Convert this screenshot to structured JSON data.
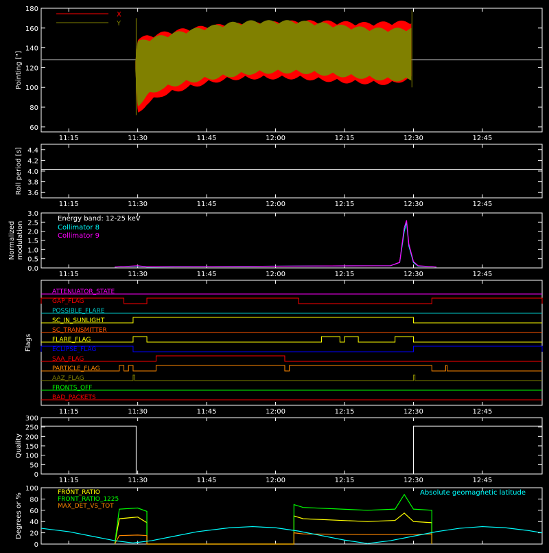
{
  "x_axis": {
    "range": [
      "11:09",
      "12:58"
    ],
    "ticks": [
      "11:15",
      "11:30",
      "11:45",
      "12:00",
      "12:15",
      "12:30",
      "12:45"
    ]
  },
  "chart_data": [
    {
      "id": "pointing",
      "type": "area",
      "ylabel": "Pointing [\"]",
      "ylim": [
        55,
        180
      ],
      "yticks": [
        60,
        80,
        100,
        120,
        140,
        160,
        180
      ],
      "reference_line": 128,
      "legend": [
        {
          "name": "X",
          "color": "#ff0000"
        },
        {
          "name": "Y",
          "color": "#808000"
        }
      ],
      "series": [
        {
          "name": "X",
          "color": "#ff0000",
          "x": [
            "11:29:30",
            "11:30",
            "11:32",
            "11:35",
            "11:40",
            "11:45",
            "11:50",
            "11:55",
            "12:00",
            "12:05",
            "12:10",
            "12:15",
            "12:20",
            "12:25",
            "12:29:40"
          ],
          "upper": [
            130,
            150,
            153,
            156,
            160,
            163,
            165,
            166,
            167,
            168,
            168,
            167,
            166,
            167,
            168
          ],
          "lower": [
            115,
            72,
            82,
            90,
            97,
            103,
            107,
            108,
            108,
            108,
            106,
            104,
            103,
            102,
            108
          ]
        },
        {
          "name": "Y",
          "color": "#808000",
          "x": [
            "11:29:30",
            "11:30",
            "11:32",
            "11:35",
            "11:40",
            "11:45",
            "11:50",
            "11:55",
            "12:00",
            "12:05",
            "12:10",
            "12:15",
            "12:20",
            "12:25",
            "12:29:40"
          ],
          "upper": [
            128,
            147,
            150,
            153,
            158,
            162,
            166,
            168,
            168,
            168,
            166,
            163,
            161,
            160,
            161
          ],
          "lower": [
            115,
            80,
            90,
            97,
            103,
            107,
            110,
            113,
            114,
            114,
            112,
            110,
            108,
            106,
            106
          ]
        }
      ]
    },
    {
      "id": "roll",
      "type": "line",
      "ylabel": "Roll period [s]",
      "ylim": [
        3.5,
        4.5
      ],
      "yticks": [
        3.6,
        3.8,
        4.0,
        4.2,
        4.4
      ],
      "series": [
        {
          "name": "roll",
          "color": "#ffffff",
          "x": [
            "11:09",
            "12:58"
          ],
          "y": [
            4.03,
            4.03
          ]
        }
      ]
    },
    {
      "id": "modulation",
      "type": "line",
      "ylabel": [
        "Normalized",
        "modulation"
      ],
      "ylim": [
        0,
        3.0
      ],
      "yticks": [
        0.0,
        0.5,
        1.0,
        1.5,
        2.0,
        2.5,
        3.0
      ],
      "legend_title": "Energy band: 12-25 keV",
      "legend": [
        {
          "name": "Collimator 8",
          "color": "#00ffff"
        },
        {
          "name": "Collimator 9",
          "color": "#ff00ff"
        }
      ],
      "series": [
        {
          "name": "Collimator 8",
          "color": "#00ffff",
          "x": [
            "11:25",
            "11:30",
            "11:32",
            "12:04",
            "12:25",
            "12:27",
            "12:28",
            "12:28:30",
            "12:29",
            "12:30",
            "12:31",
            "12:35"
          ],
          "y": [
            0.05,
            0.1,
            0.05,
            0.1,
            0.12,
            0.3,
            2.0,
            2.5,
            1.2,
            0.3,
            0.1,
            0.05
          ]
        },
        {
          "name": "Collimator 9",
          "color": "#ff00ff",
          "x": [
            "11:25",
            "11:30",
            "11:32",
            "12:04",
            "12:25",
            "12:27",
            "12:28",
            "12:28:30",
            "12:29",
            "12:30",
            "12:31",
            "12:35"
          ],
          "y": [
            0.05,
            0.12,
            0.06,
            0.1,
            0.12,
            0.3,
            2.2,
            2.6,
            1.3,
            0.35,
            0.12,
            0.05
          ]
        }
      ]
    },
    {
      "id": "flags",
      "type": "line",
      "ylabel": "Flags",
      "flags": [
        {
          "name": "ATTENUATOR_STATE",
          "color": "#ff00ff",
          "high": []
        },
        {
          "name": "GAP_FLAG",
          "color": "#ff0000",
          "high": [
            [
              "11:09",
              "11:27"
            ],
            [
              "11:32",
              "12:05"
            ],
            [
              "12:34",
              "12:58"
            ]
          ]
        },
        {
          "name": "POSSIBLE_FLARE",
          "color": "#00cccc",
          "high": []
        },
        {
          "name": "SC_IN_SUNLIGHT",
          "color": "#ffff00",
          "high": [
            [
              "11:29",
              "12:30"
            ]
          ]
        },
        {
          "name": "SC_TRANSMITTER",
          "color": "#ff5500",
          "high": []
        },
        {
          "name": "FLARE_FLAG",
          "color": "#ffff00",
          "high": [
            [
              "11:29",
              "11:32"
            ],
            [
              "12:10",
              "12:14"
            ],
            [
              "12:15",
              "12:18"
            ],
            [
              "12:26",
              "12:30"
            ]
          ]
        },
        {
          "name": "ECLIPSE_FLAG",
          "color": "#0000ff",
          "high": [
            [
              "11:09",
              "11:29"
            ],
            [
              "12:30",
              "12:58"
            ]
          ]
        },
        {
          "name": "SAA_FLAG",
          "color": "#ff0000",
          "high": [
            [
              "11:34",
              "12:02"
            ]
          ]
        },
        {
          "name": "PARTICLE_FLAG",
          "color": "#ff8800",
          "high": [
            [
              "11:26",
              "11:27"
            ],
            [
              "11:28",
              "11:29"
            ],
            [
              "11:34",
              "12:02"
            ],
            [
              "12:03",
              "12:34"
            ],
            [
              "12:37",
              "12:37:20"
            ]
          ]
        },
        {
          "name": "AAZ_FLAG",
          "color": "#808000",
          "high": [
            [
              "11:29",
              "11:29:20"
            ],
            [
              "12:30",
              "12:30:20"
            ]
          ]
        },
        {
          "name": "FRONTS_OFF",
          "color": "#00ff00",
          "high": []
        },
        {
          "name": "BAD_PACKETS",
          "color": "#ff0000",
          "high": []
        }
      ]
    },
    {
      "id": "quality",
      "type": "line",
      "ylabel": "Quality",
      "ylim": [
        0,
        300
      ],
      "yticks": [
        0,
        50,
        100,
        150,
        200,
        250,
        300
      ],
      "series": [
        {
          "name": "quality",
          "color": "#ffffff",
          "x": [
            "11:09",
            "11:29:40",
            "11:29:40",
            "12:30",
            "12:30",
            "12:58"
          ],
          "y": [
            255,
            255,
            0,
            0,
            255,
            255
          ]
        }
      ]
    },
    {
      "id": "ratios",
      "type": "line",
      "ylabel": "Degrees or %",
      "ylim": [
        0,
        100
      ],
      "yticks": [
        0,
        20,
        40,
        60,
        80,
        100
      ],
      "legend": [
        {
          "name": "FRONT_RATIO",
          "color": "#ffff00"
        },
        {
          "name": "FRONT_RATIO_1225",
          "color": "#00ff00"
        },
        {
          "name": "MAX_DET_VS_TOT",
          "color": "#ff8800"
        }
      ],
      "annotation": {
        "text": "Absolute geomagnetic latitude",
        "color": "#00ffff"
      },
      "series": [
        {
          "name": "FRONT_RATIO",
          "color": "#ffff00",
          "x": [
            "11:25",
            "11:26",
            "11:30",
            "11:32",
            "11:32",
            "12:04",
            "12:04",
            "12:06",
            "12:20",
            "12:26",
            "12:28",
            "12:30",
            "12:34",
            "12:34"
          ],
          "y": [
            0,
            45,
            48,
            38,
            0,
            0,
            50,
            45,
            40,
            42,
            55,
            40,
            38,
            0
          ]
        },
        {
          "name": "FRONT_RATIO_1225",
          "color": "#00ff00",
          "x": [
            "11:25",
            "11:26",
            "11:30",
            "11:32",
            "11:32",
            "12:04",
            "12:04",
            "12:06",
            "12:20",
            "12:26",
            "12:28",
            "12:30",
            "12:34",
            "12:34"
          ],
          "y": [
            0,
            62,
            64,
            58,
            0,
            0,
            70,
            65,
            60,
            62,
            88,
            62,
            60,
            0
          ]
        },
        {
          "name": "MAX_DET_VS_TOT",
          "color": "#ff8800",
          "x": [
            "11:25",
            "11:26",
            "11:30",
            "11:32",
            "11:32",
            "12:04",
            "12:04",
            "12:06",
            "12:20",
            "12:30",
            "12:34",
            "12:34"
          ],
          "y": [
            0,
            15,
            16,
            15,
            0,
            0,
            20,
            18,
            17,
            17,
            18,
            0
          ]
        },
        {
          "name": "Absolute geomagnetic latitude",
          "color": "#00ffff",
          "x": [
            "11:09",
            "11:15",
            "11:20",
            "11:25",
            "11:29",
            "11:33",
            "11:38",
            "11:43",
            "11:50",
            "11:55",
            "12:00",
            "12:05",
            "12:10",
            "12:15",
            "12:20",
            "12:25",
            "12:30",
            "12:35",
            "12:40",
            "12:45",
            "12:50",
            "12:55",
            "12:58"
          ],
          "y": [
            28,
            22,
            14,
            6,
            2,
            6,
            14,
            22,
            29,
            31,
            29,
            23,
            15,
            7,
            1,
            6,
            14,
            22,
            28,
            31,
            29,
            24,
            20
          ]
        }
      ]
    }
  ]
}
